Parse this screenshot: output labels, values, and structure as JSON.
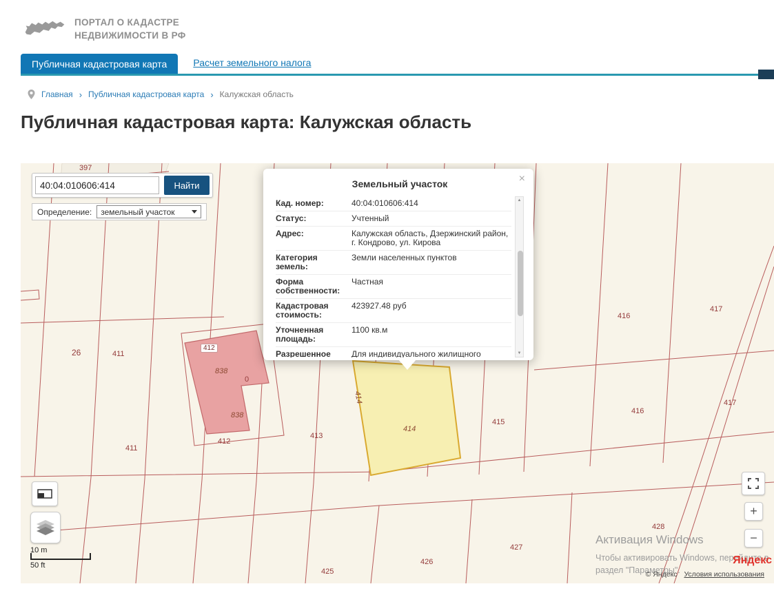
{
  "header": {
    "logo_title_line1": "ПОРТАЛ О КАДАСТРЕ",
    "logo_title_line2": "НЕДВИЖИМОСТИ В РФ"
  },
  "nav": {
    "active_tab": "Публичная кадастровая карта",
    "link_tab": "Расчет земельного налога"
  },
  "breadcrumb": {
    "separator": "›",
    "items": [
      {
        "label": "Главная"
      },
      {
        "label": "Публичная кадастровая карта"
      },
      {
        "label": "Калужская область"
      }
    ]
  },
  "page_title": "Публичная кадастровая карта: Калужская область",
  "icons": {
    "scroll_up": "▲",
    "scroll_down": "▼"
  },
  "map": {
    "search": {
      "value": "40:04:010606:414",
      "button_label": "Найти"
    },
    "filter": {
      "label": "Определение:",
      "selected_option": "земельный участок"
    },
    "popup": {
      "title": "Земельный участок",
      "close_label": "×",
      "rows": [
        {
          "label": "Кад. номер:",
          "value": "40:04:010606:414"
        },
        {
          "label": "Статус:",
          "value": "Учтенный"
        },
        {
          "label": "Адрес:",
          "value": "Калужская область, Дзержинский район, г. Кондрово, ул. Кирова"
        },
        {
          "label": "Категория земель:",
          "value": "Земли населенных пунктов"
        },
        {
          "label": "Форма собственности:",
          "value": "Частная"
        },
        {
          "label": "Кадастровая стоимость:",
          "value": "423927.48 руб"
        },
        {
          "label": "Уточненная площадь:",
          "value": "1100 кв.м"
        },
        {
          "label": "Разрешенное",
          "value": "Для индивидуального жилищного"
        }
      ]
    },
    "labels": [
      {
        "text": "397"
      },
      {
        "text": "26"
      },
      {
        "text": "411"
      },
      {
        "text": "412"
      },
      {
        "text": "838"
      },
      {
        "text": "0"
      },
      {
        "text": "838"
      },
      {
        "text": "412"
      },
      {
        "text": "413"
      },
      {
        "text": "414"
      },
      {
        "text": "414"
      },
      {
        "text": "415"
      },
      {
        "text": "416"
      },
      {
        "text": "417"
      },
      {
        "text": "416"
      },
      {
        "text": "417"
      },
      {
        "text": "411"
      },
      {
        "text": "425"
      },
      {
        "text": "426"
      },
      {
        "text": "427"
      },
      {
        "text": "428"
      }
    ],
    "scale": {
      "metric": "10 m",
      "imperial": "50 ft"
    },
    "controls": {
      "zoom_in": "+",
      "zoom_out": "−"
    },
    "watermark": {
      "line1": "Активация Windows",
      "line2": "Чтобы активировать Windows, перейдите в",
      "line3": "раздел \"Параметры\"."
    },
    "attribution": {
      "logo": "Яндекс",
      "copyright": "© Яндекс",
      "terms_link": "Условия использования"
    }
  },
  "colors": {
    "accent_blue": "#1177b5",
    "teal_line": "#2a99b0",
    "nav_end_block": "#1c3e57",
    "find_button": "#17527f",
    "map_background": "#f8f4e9",
    "parcel_line": "#b85c5c",
    "parcel_text": "#943b3b",
    "selected_parcel_fill": "#f7efb2",
    "selected_parcel_border": "#d9a92f",
    "building_fill": "#e8a2a2",
    "yandex_red": "#e0332c"
  }
}
